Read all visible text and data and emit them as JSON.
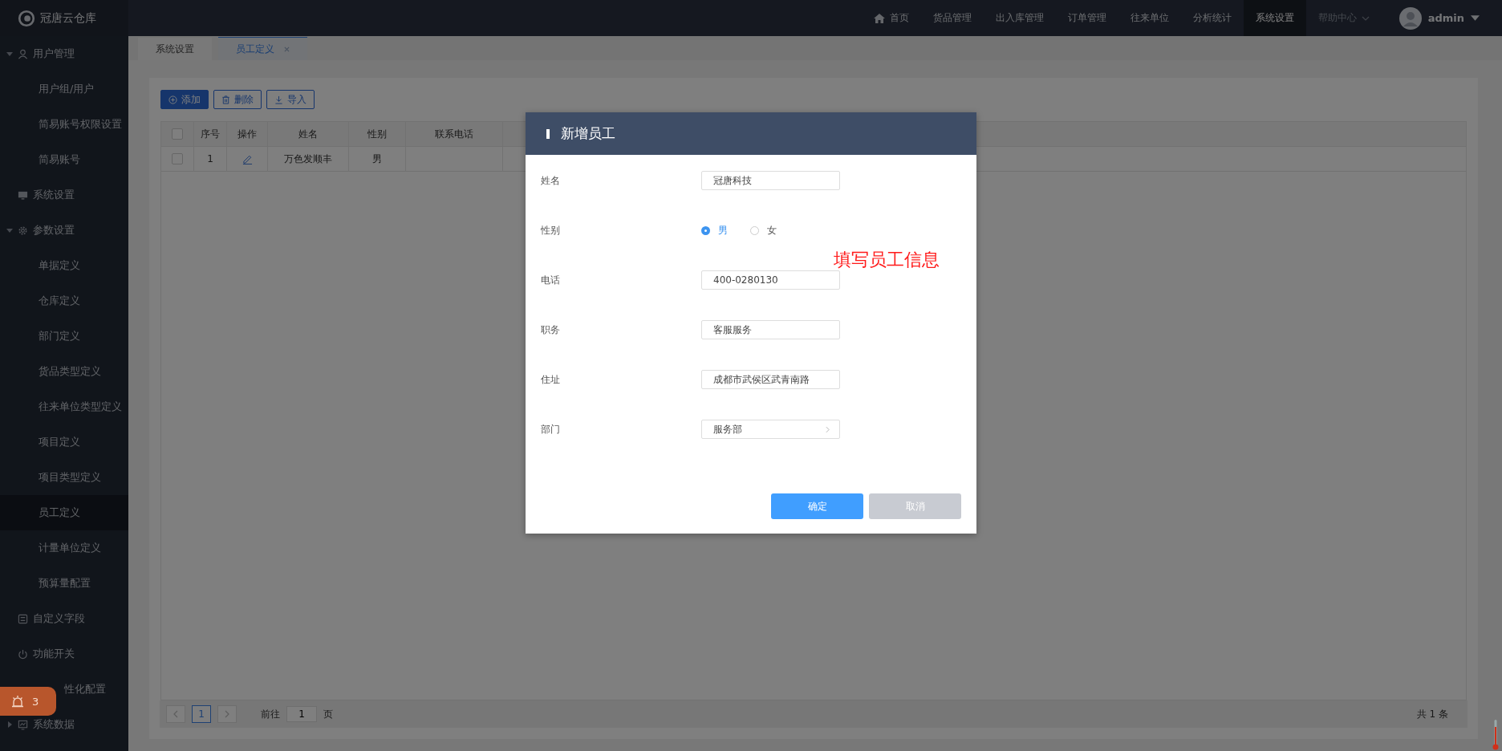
{
  "app": {
    "name": "冠唐云仓库"
  },
  "top_nav": [
    {
      "label": "首页",
      "selected": false,
      "kind": "home"
    },
    {
      "label": "货品管理",
      "selected": false,
      "kind": "plain"
    },
    {
      "label": "出入库管理",
      "selected": false,
      "kind": "plain"
    },
    {
      "label": "订单管理",
      "selected": false,
      "kind": "plain"
    },
    {
      "label": "往来单位",
      "selected": false,
      "kind": "plain"
    },
    {
      "label": "分析统计",
      "selected": false,
      "kind": "plain"
    },
    {
      "label": "系统设置",
      "selected": true,
      "kind": "plain"
    },
    {
      "label": "帮助中心",
      "selected": false,
      "kind": "dropdown"
    }
  ],
  "user": {
    "name": "admin"
  },
  "sidebar": {
    "items": [
      {
        "label": "用户管理",
        "expanded": true,
        "children": [
          {
            "label": "用户组/用户",
            "selected": false
          },
          {
            "label": "简易账号权限设置",
            "selected": false
          },
          {
            "label": "简易账号",
            "selected": false
          }
        ]
      },
      {
        "label": "系统设置"
      },
      {
        "label": "参数设置",
        "expanded": true,
        "children": [
          {
            "label": "单据定义",
            "selected": false
          },
          {
            "label": "仓库定义",
            "selected": false
          },
          {
            "label": "部门定义",
            "selected": false
          },
          {
            "label": "货品类型定义",
            "selected": false
          },
          {
            "label": "往来单位类型定义",
            "selected": false
          },
          {
            "label": "项目定义",
            "selected": false
          },
          {
            "label": "项目类型定义",
            "selected": false
          },
          {
            "label": "员工定义",
            "selected": true
          },
          {
            "label": "计量单位定义",
            "selected": false
          },
          {
            "label": "预算量配置",
            "selected": false
          }
        ]
      },
      {
        "label": "自定义字段"
      },
      {
        "label": "功能开关"
      },
      {
        "label": "性化配置"
      },
      {
        "label": "系统数据",
        "expanded": false
      }
    ]
  },
  "notification_badge": {
    "count": "3"
  },
  "tabs": [
    {
      "label": "系统设置",
      "selected": false,
      "closable": false
    },
    {
      "label": "员工定义",
      "selected": true,
      "closable": true
    }
  ],
  "toolbar": [
    {
      "label": "添加",
      "kind": "add"
    },
    {
      "label": "删除",
      "kind": "delete"
    },
    {
      "label": "导入",
      "kind": "import"
    }
  ],
  "table": {
    "all_checked": false,
    "columns": [
      "序号",
      "操作",
      "姓名",
      "性别",
      "联系电话"
    ],
    "rows": [
      {
        "checked": false,
        "cells": [
          "1",
          "",
          "万色发顺丰",
          "男",
          ""
        ]
      }
    ]
  },
  "pagination": {
    "page": "1",
    "goto_label": "前往",
    "goto_value": "1",
    "page_unit": "页",
    "total": "共 1 条"
  },
  "dialog": {
    "title": "新增员工",
    "fields": [
      {
        "kind": "text",
        "label": "姓名",
        "value": "冠唐科技"
      },
      {
        "kind": "radio",
        "label": "性别",
        "options": [
          {
            "label": "男",
            "selected": true
          },
          {
            "label": "女",
            "selected": false
          }
        ]
      },
      {
        "kind": "text",
        "label": "电话",
        "value": "400-0280130"
      },
      {
        "kind": "text",
        "label": "职务",
        "value": "客服服务"
      },
      {
        "kind": "text",
        "label": "住址",
        "value": "成都市武侯区武青南路"
      },
      {
        "kind": "select",
        "label": "部门",
        "value": "服务部"
      }
    ],
    "annotation": "填写员工信息",
    "buttons": [
      {
        "label": "确定",
        "kind": "primary"
      },
      {
        "label": "取消",
        "kind": "secondary"
      }
    ]
  }
}
